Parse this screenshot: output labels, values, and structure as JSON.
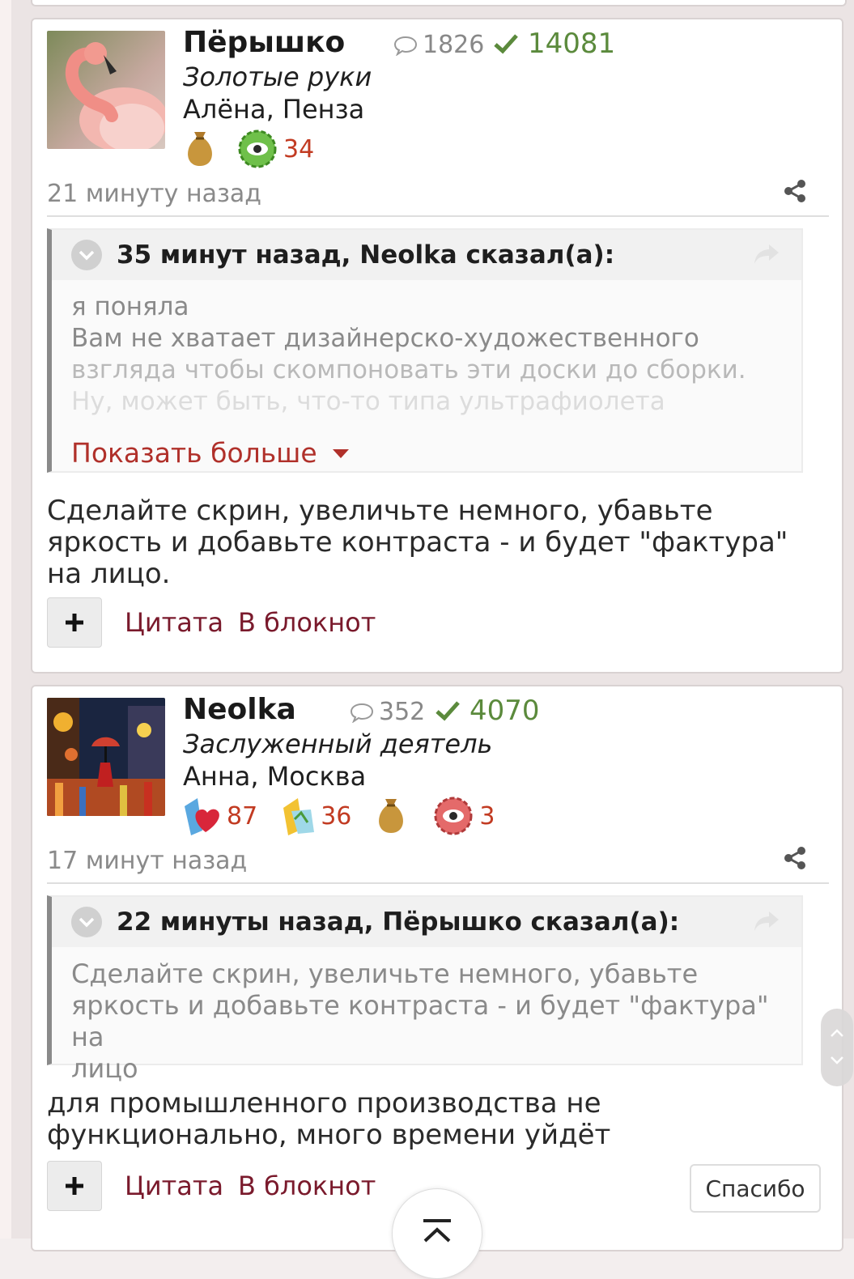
{
  "posts": [
    {
      "username": "Пёрышко",
      "comments_count": "1826",
      "reputation": "14081",
      "user_title": "Золотые руки",
      "location": "Алёна, Пенза",
      "badges": [
        {
          "icon": "money-bag-icon",
          "count": ""
        },
        {
          "icon": "green-gear-eye-icon",
          "count": "34"
        }
      ],
      "time": "21 минуту назад",
      "quote": {
        "header": "35 минут назад, Neolka сказал(а):",
        "lines": [
          "я поняла",
          "Вам не хватает дизайнерско-художественного",
          "взгляда чтобы скомпоновать эти доски до сборки.",
          "Ну, может быть, что-то типа ультрафиолета"
        ],
        "show_more": "Показать больше"
      },
      "text": "Сделайте скрин, увеличьте немного, убавьте яркость и добавьте контраста - и будет \"фактура\" на лицо.",
      "actions": {
        "quote": "Цитата",
        "notebook": "В блокнот"
      }
    },
    {
      "username": "Neolka",
      "comments_count": "352",
      "reputation": "4070",
      "user_title": "Заслуженный деятель",
      "location": "Анна, Москва",
      "badges": [
        {
          "icon": "heart-book-icon",
          "count": "87"
        },
        {
          "icon": "yellow-book-icon",
          "count": "36"
        },
        {
          "icon": "money-bag-icon",
          "count": ""
        },
        {
          "icon": "red-gear-eye-icon",
          "count": "3"
        }
      ],
      "time": "17 минут назад",
      "quote": {
        "header": "22 минуты назад, Пёрышко сказал(а):",
        "lines": [
          "Сделайте скрин, увеличьте немного, убавьте",
          "яркость и добавьте контраста - и будет \"фактура\" на",
          "лицо"
        ]
      },
      "text": "для промышленного производства не функционально, много времени уйдёт",
      "actions": {
        "quote": "Цитата",
        "notebook": "В блокнот",
        "thanks": "Спасибо"
      }
    }
  ],
  "colors": {
    "reputation": "#5b8a3c",
    "badge_count": "#c23b22",
    "action_link": "#7a1a2c",
    "show_more": "#b0302a"
  }
}
